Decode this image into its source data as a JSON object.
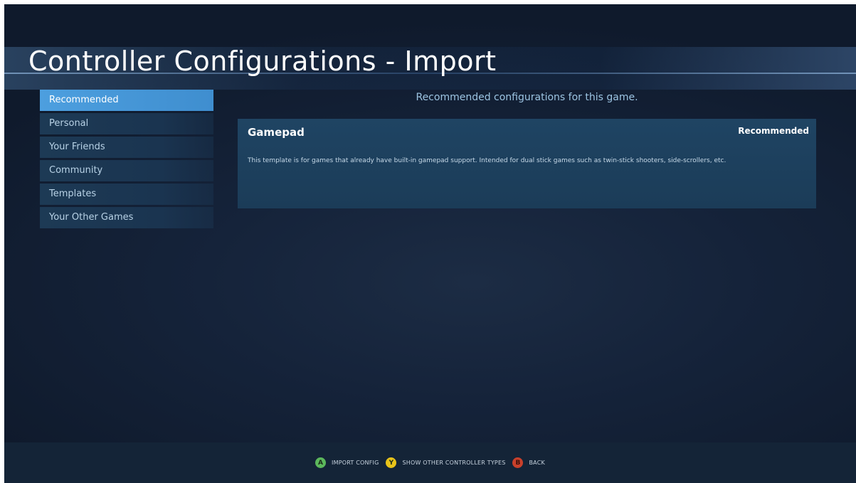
{
  "title": "Controller Configurations - Import",
  "sidebar": {
    "items": [
      {
        "label": "Recommended"
      },
      {
        "label": "Personal"
      },
      {
        "label": "Your Friends"
      },
      {
        "label": "Community"
      },
      {
        "label": "Templates"
      },
      {
        "label": "Your Other Games"
      }
    ]
  },
  "main": {
    "subtitle": "Recommended configurations for this game.",
    "configs": [
      {
        "name": "Gamepad",
        "badge": "Recommended",
        "description": "This template is for games that already have built-in gamepad support.  Intended for dual stick games such as twin-stick shooters, side-scrollers, etc."
      }
    ]
  },
  "footer": {
    "hints": [
      {
        "button": "A",
        "label": "IMPORT CONFIG",
        "color": "#5cb85c"
      },
      {
        "button": "Y",
        "label": "SHOW OTHER CONTROLLER TYPES",
        "color": "#e8c31a"
      },
      {
        "button": "B",
        "label": "BACK",
        "color": "#c9402b"
      }
    ]
  }
}
